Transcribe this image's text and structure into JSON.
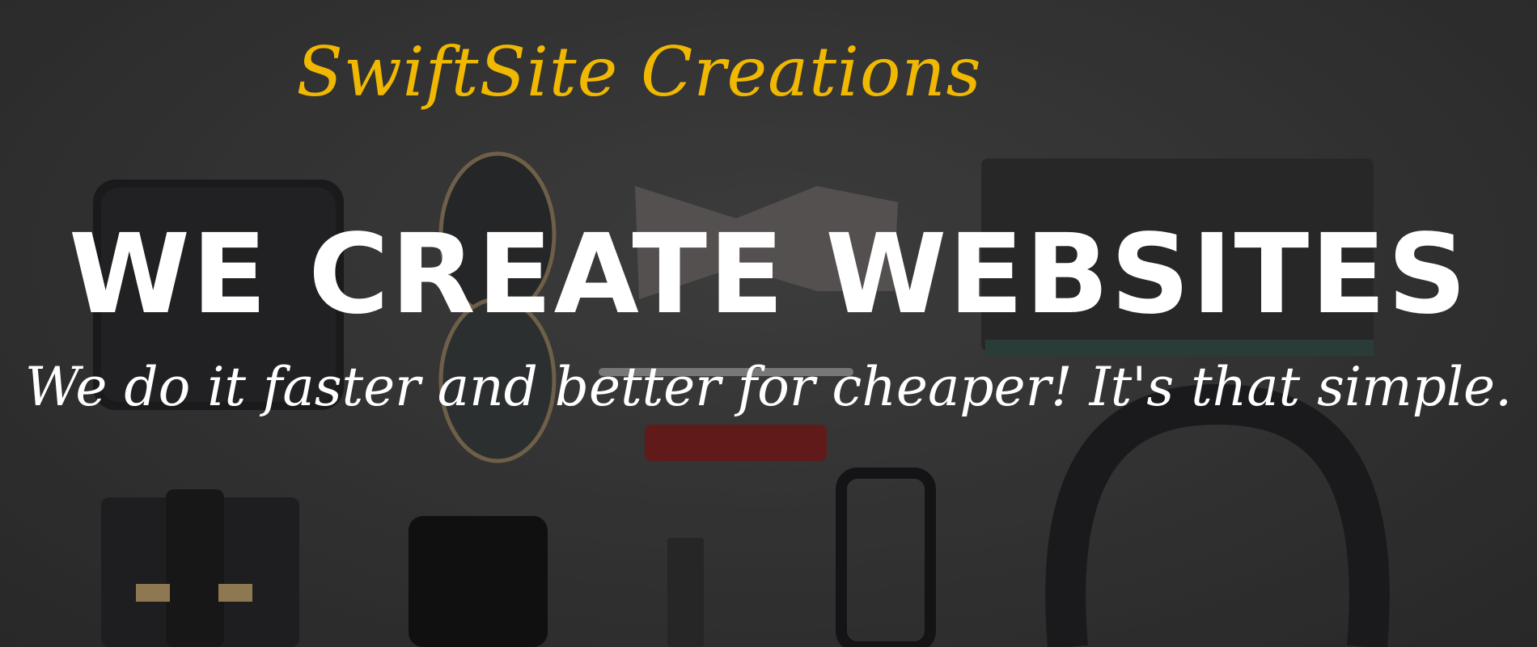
{
  "hero": {
    "brand": "SwiftSite Creations",
    "headline": "WE CREATE WEBSITES",
    "tagline": "We do it faster and better for cheaper! It's that simple."
  },
  "colors": {
    "brand_accent": "#f0b800",
    "headline_text": "#ffffff",
    "background": "#3a3a3a"
  },
  "background_image": {
    "items": [
      "wallet-icon",
      "sunglasses-icon",
      "bow-tie-icon",
      "notebook-icon",
      "pen-icon",
      "lipstick-icon",
      "headphones-icon",
      "card-holder-icon",
      "smartphone-icon",
      "watch-icon",
      "eyeglasses-icon"
    ]
  }
}
